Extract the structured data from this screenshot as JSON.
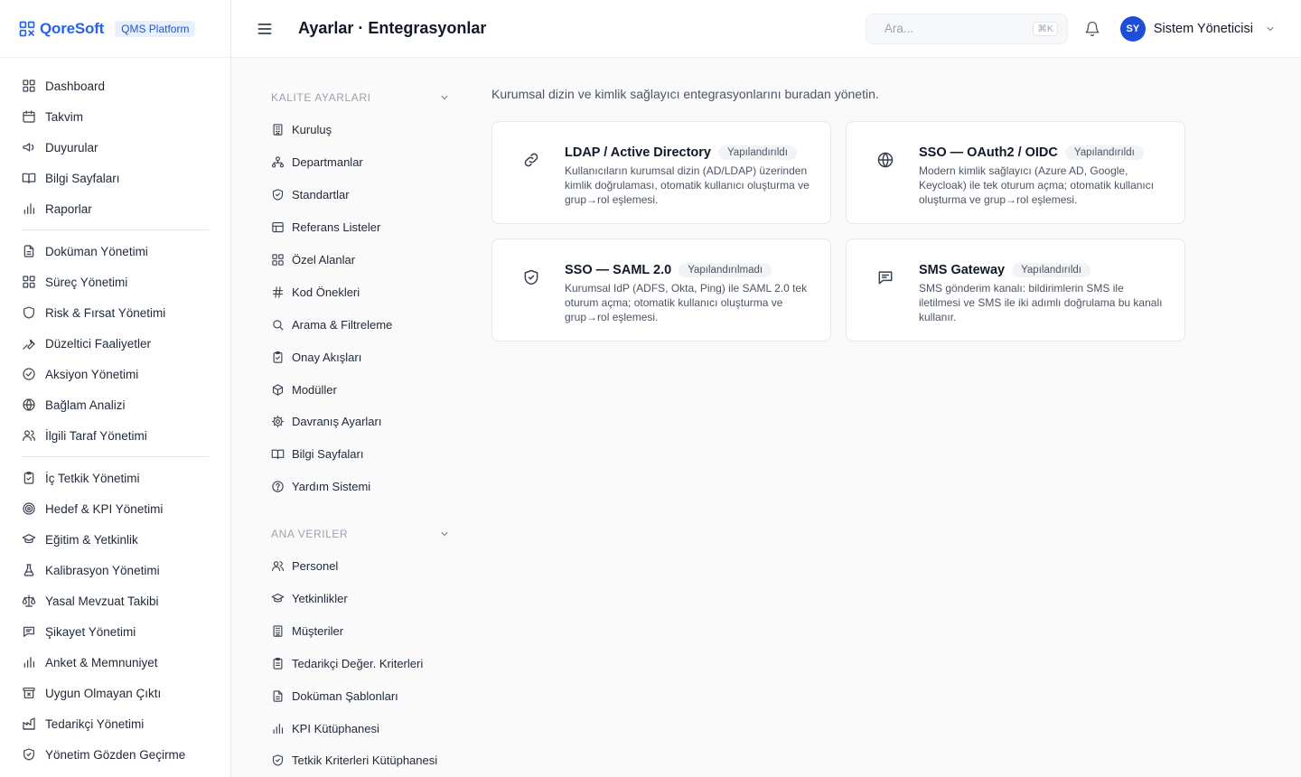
{
  "brand": {
    "logo_text": "QoreSoft",
    "platform": "QMS Platform",
    "accent": "#2563eb"
  },
  "sidebar": {
    "groups": [
      [
        {
          "label": "Dashboard",
          "icon": "grid-icon"
        },
        {
          "label": "Takvim",
          "icon": "calendar-icon"
        },
        {
          "label": "Duyurular",
          "icon": "megaphone-icon"
        },
        {
          "label": "Bilgi Sayfaları",
          "icon": "book-icon"
        },
        {
          "label": "Raporlar",
          "icon": "bar-chart-icon"
        }
      ],
      [
        {
          "label": "Doküman Yönetimi",
          "icon": "document-icon"
        },
        {
          "label": "Süreç Yönetimi",
          "icon": "grid-icon"
        },
        {
          "label": "Risk & Fırsat Yönetimi",
          "icon": "shield-icon"
        },
        {
          "label": "Düzeltici Faaliyetler",
          "icon": "wrench-icon"
        },
        {
          "label": "Aksiyon Yönetimi",
          "icon": "check-circle-icon"
        },
        {
          "label": "Bağlam Analizi",
          "icon": "globe-icon"
        },
        {
          "label": "İlgili Taraf Yönetimi",
          "icon": "users-icon"
        }
      ],
      [
        {
          "label": "İç Tetkik Yönetimi",
          "icon": "clipboard-check-icon"
        },
        {
          "label": "Hedef & KPI Yönetimi",
          "icon": "target-icon"
        },
        {
          "label": "Eğitim & Yetkinlik",
          "icon": "graduation-cap-icon"
        },
        {
          "label": "Kalibrasyon Yönetimi",
          "icon": "flask-icon"
        },
        {
          "label": "Yasal Mevzuat Takibi",
          "icon": "scale-icon"
        },
        {
          "label": "Şikayet Yönetimi",
          "icon": "message-icon"
        },
        {
          "label": "Anket & Memnuniyet",
          "icon": "bar-chart-icon"
        },
        {
          "label": "Uygun Olmayan Çıktı",
          "icon": "archive-x-icon"
        },
        {
          "label": "Tedarikçi Yönetimi",
          "icon": "factory-icon"
        },
        {
          "label": "Yönetim Gözden Geçirme",
          "icon": "shield-check-icon"
        }
      ]
    ]
  },
  "header": {
    "title": "Ayarlar · Entegrasyonlar",
    "search_placeholder": "Ara...",
    "search_shortcut": "⌘K",
    "user_initials": "SY",
    "user_name": "Sistem Yöneticisi"
  },
  "subnav": {
    "sections": [
      {
        "title": "Kalite Ayarları",
        "items": [
          {
            "label": "Kuruluş",
            "icon": "building-icon"
          },
          {
            "label": "Departmanlar",
            "icon": "org-chart-icon"
          },
          {
            "label": "Standartlar",
            "icon": "shield-check-icon"
          },
          {
            "label": "Referans Listeler",
            "icon": "table-icon"
          },
          {
            "label": "Özel Alanlar",
            "icon": "grid-icon"
          },
          {
            "label": "Kod Önekleri",
            "icon": "hash-icon"
          },
          {
            "label": "Arama & Filtreleme",
            "icon": "search-icon"
          },
          {
            "label": "Onay Akışları",
            "icon": "clipboard-check-icon"
          },
          {
            "label": "Modüller",
            "icon": "package-icon"
          },
          {
            "label": "Davranış Ayarları",
            "icon": "gear-icon"
          },
          {
            "label": "Bilgi Sayfaları",
            "icon": "book-icon"
          },
          {
            "label": "Yardım Sistemi",
            "icon": "help-circle-icon"
          }
        ]
      },
      {
        "title": "Ana Veriler",
        "items": [
          {
            "label": "Personel",
            "icon": "users-icon"
          },
          {
            "label": "Yetkinlikler",
            "icon": "graduation-cap-icon"
          },
          {
            "label": "Müşteriler",
            "icon": "building-icon"
          },
          {
            "label": "Tedarikçi Değer. Kriterleri",
            "icon": "clipboard-icon"
          },
          {
            "label": "Doküman Şablonları",
            "icon": "document-icon"
          },
          {
            "label": "KPI Kütüphanesi",
            "icon": "bar-chart-icon"
          },
          {
            "label": "Tetkik Kriterleri Kütüphanesi",
            "icon": "shield-check-icon"
          }
        ]
      }
    ]
  },
  "content": {
    "intro": "Kurumsal dizin ve kimlik sağlayıcı entegrasyonlarını buradan yönetin.",
    "cards": [
      {
        "title": "LDAP / Active Directory",
        "status": "Yapılandırıldı",
        "icon": "link-icon",
        "description": "Kullanıcıların kurumsal dizin (AD/LDAP) üzerinden kimlik doğrulaması, otomatik kullanıcı oluşturma ve grup→rol eşlemesi."
      },
      {
        "title": "SSO — OAuth2 / OIDC",
        "status": "Yapılandırıldı",
        "icon": "globe-icon",
        "description": "Modern kimlik sağlayıcı (Azure AD, Google, Keycloak) ile tek oturum açma; otomatik kullanıcı oluşturma ve grup→rol eşlemesi."
      },
      {
        "title": "SSO — SAML 2.0",
        "status": "Yapılandırılmadı",
        "icon": "shield-check-icon",
        "description": "Kurumsal IdP (ADFS, Okta, Ping) ile SAML 2.0 tek oturum açma; otomatik kullanıcı oluşturma ve grup→rol eşlemesi."
      },
      {
        "title": "SMS Gateway",
        "status": "Yapılandırıldı",
        "icon": "message-icon",
        "description": "SMS gönderim kanalı: bildirimlerin SMS ile iletilmesi ve SMS ile iki adımlı doğrulama bu kanalı kullanır."
      }
    ]
  }
}
